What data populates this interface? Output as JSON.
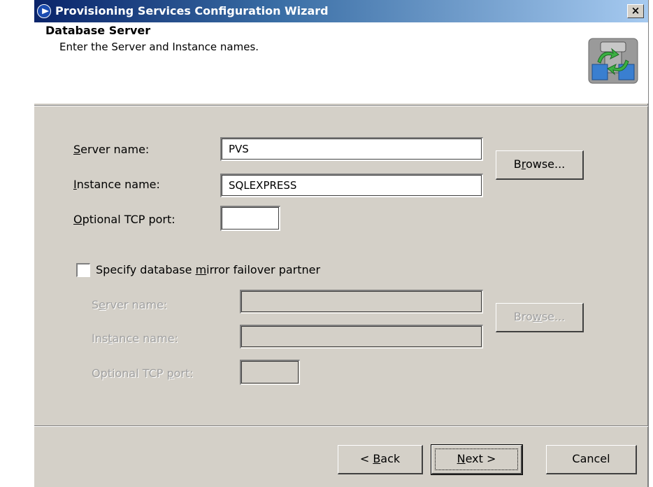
{
  "window": {
    "title": "Provisioning Services Configuration Wizard",
    "close_glyph": "×"
  },
  "header": {
    "title": "Database Server",
    "subtitle": "Enter the Server and Instance names.",
    "icon": "server-sync-icon"
  },
  "primary": {
    "server_label": {
      "pre": "",
      "key": "S",
      "post": "erver name:"
    },
    "server_value": "PVS",
    "instance_label": {
      "pre": "",
      "key": "I",
      "post": "nstance name:"
    },
    "instance_value": "SQLEXPRESS",
    "port_label": {
      "pre": "",
      "key": "O",
      "post": "ptional TCP port:"
    },
    "port_value": "",
    "browse": {
      "pre": "B",
      "key": "r",
      "post": "owse..."
    }
  },
  "mirror": {
    "checkbox_label": {
      "pre": "Specify database ",
      "key": "m",
      "post": "irror failover partner"
    },
    "checked": false,
    "server_label": {
      "pre": "S",
      "key": "e",
      "post": "rver name:"
    },
    "server_value": "",
    "instance_label": {
      "pre": "Ins",
      "key": "t",
      "post": "ance name:"
    },
    "instance_value": "",
    "port_label": {
      "pre": "Optional TCP ",
      "key": "p",
      "post": "ort:"
    },
    "port_value": "",
    "browse": {
      "pre": "Bro",
      "key": "w",
      "post": "se..."
    }
  },
  "footer": {
    "back": {
      "pre": "< ",
      "key": "B",
      "post": "ack"
    },
    "next": {
      "pre": "",
      "key": "N",
      "post": "ext >"
    },
    "cancel": "Cancel"
  },
  "colors": {
    "dialog_bg": "#d4d0c8",
    "title_gradient_start": "#0a246a",
    "title_gradient_end": "#a6caf0",
    "disabled_text": "#a0a0a0"
  }
}
